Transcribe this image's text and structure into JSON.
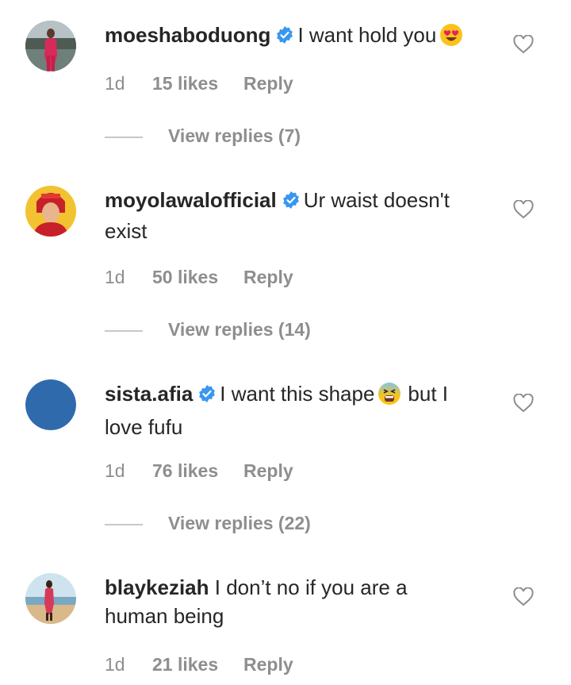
{
  "comments": [
    {
      "username": "moeshaboduong",
      "text": "I want hold you",
      "text2": "",
      "emoji": "heart-eyes-emoji",
      "time": "1d",
      "likes": "15 likes",
      "reply": "Reply",
      "view_replies": "View replies (7)",
      "avatar": "avatar-photo-person-red-outfit"
    },
    {
      "username": "moyolawalofficial",
      "text": "Ur waist doesn't",
      "text2": "exist",
      "time": "1d",
      "likes": "50 likes",
      "reply": "Reply",
      "view_replies": "View replies (14)",
      "avatar": "avatar-photo-red-headwrap"
    },
    {
      "username": "sista.afia",
      "text": "I want this shape",
      "text_after_emoji": "but I",
      "text2": "love fufu",
      "emoji": "tired-face-emoji",
      "time": "1d",
      "likes": "76 likes",
      "reply": "Reply",
      "view_replies": "View replies (22)",
      "avatar": "avatar-solid-blue"
    },
    {
      "username": "blaykeziah",
      "text": "I don’t no if you are a",
      "text2": "human being",
      "time": "1d",
      "likes": "21 likes",
      "reply": "Reply",
      "avatar": "avatar-photo-beach"
    }
  ],
  "colors": {
    "text": "#262626",
    "muted": "#8e8e8e",
    "verified": "#3897f0",
    "divider": "#c7c7c7",
    "avatar_blue": "#2f6aad"
  },
  "icons": {
    "verified": "verified-badge-icon",
    "like": "heart-outline-icon"
  }
}
